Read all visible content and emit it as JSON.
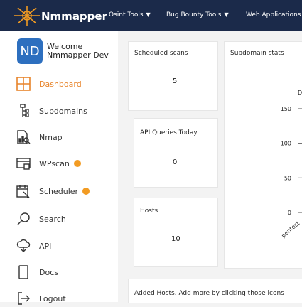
{
  "brand": {
    "name": "Nmmapper"
  },
  "nav": [
    {
      "label": "Osint Tools",
      "caret": "▼"
    },
    {
      "label": "Bug Bounty Tools",
      "caret": "▼"
    },
    {
      "label": "Web Applications"
    }
  ],
  "user": {
    "initials": "ND",
    "greeting": "Welcome",
    "name": "Nmmapper Dev"
  },
  "sidebar": {
    "items": [
      {
        "label": "Dashboard",
        "icon": "dashboard-icon",
        "active": true
      },
      {
        "label": "Subdomains",
        "icon": "sitemap-icon"
      },
      {
        "label": "Nmap",
        "icon": "network-scan-icon"
      },
      {
        "label": "WPscan",
        "icon": "browser-window-icon",
        "badge": true
      },
      {
        "label": "Scheduler",
        "icon": "calendar-icon",
        "badge": true
      },
      {
        "label": "Search",
        "icon": "search-icon"
      },
      {
        "label": "API",
        "icon": "cloud-api-icon"
      },
      {
        "label": "Docs",
        "icon": "document-icon"
      },
      {
        "label": "Logout",
        "icon": "logout-icon"
      }
    ]
  },
  "cards": {
    "scheduled": {
      "title": "Scheduled scans",
      "value": "5"
    },
    "api": {
      "title": "API Queries Today",
      "value": "0"
    },
    "hosts": {
      "title": "Hosts",
      "value": "10"
    },
    "subdomain_stats": {
      "title": "Subdomain stats"
    },
    "added_hosts": {
      "text": "Added Hosts. Add more by clicking those icons"
    }
  },
  "chart_data": {
    "type": "bar",
    "title": "",
    "ylim": [
      0,
      160
    ],
    "y_ticks": [
      "150",
      "100",
      "50",
      "0"
    ],
    "categories": [
      "pentest"
    ],
    "legend_partial": "D"
  },
  "colors": {
    "accent": "#e8842a",
    "topbar": "#1b2a4a",
    "avatar": "#2d6fbf",
    "badge": "#f29b22"
  }
}
